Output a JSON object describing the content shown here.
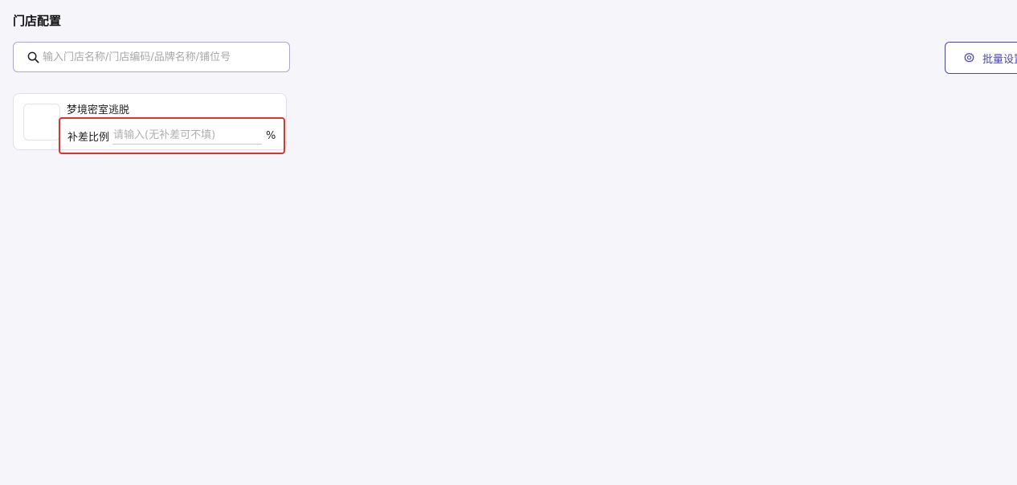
{
  "header": {
    "title": "门店配置"
  },
  "search": {
    "placeholder": "输入门店名称/门店编码/品牌名称/铺位号",
    "value": ""
  },
  "toolbar": {
    "batch_label": "批量设置"
  },
  "stores": [
    {
      "name": "梦境密室逃脱",
      "ratio_label": "补差比例",
      "ratio_placeholder": "请输入(无补差可不填)",
      "ratio_value": "",
      "ratio_unit": "%"
    }
  ],
  "colors": {
    "accent": "#4b44b8",
    "highlight": "#e0342b",
    "background": "#f6f5fa"
  },
  "icons": {
    "search": "search-icon",
    "batch": "gear-icon"
  }
}
